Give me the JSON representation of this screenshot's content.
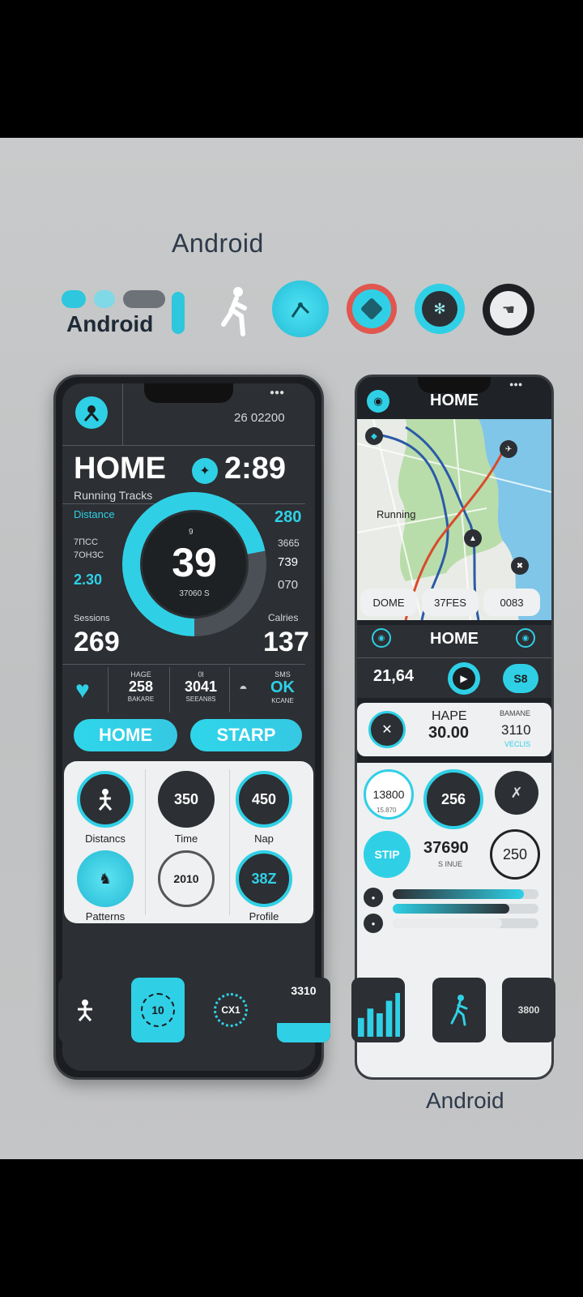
{
  "brand": {
    "title": "Android",
    "footer": "Android",
    "logo_text": "Android"
  },
  "colors": {
    "accent": "#2fd0e6",
    "dark": "#2c2f33",
    "light": "#eef0f1",
    "red": "#e0574f"
  },
  "icons_row": [
    "runner-icon",
    "route-icon",
    "cube-icon",
    "fan-icon",
    "pointer-icon"
  ],
  "left_phone": {
    "status_value": "26 02200",
    "title": "HOME",
    "clock": "2:89",
    "subtitle": "Running Tracks",
    "left_stats": [
      {
        "label": "Distance",
        "value": ""
      },
      {
        "label": "7ПСС",
        "value": ""
      },
      {
        "label": "7ОНЗС",
        "value": ""
      },
      {
        "label": "",
        "value": "2.30"
      }
    ],
    "right_stats": [
      "280",
      "3665",
      "739",
      "070"
    ],
    "ring": {
      "top": "9",
      "value": "39",
      "sub": "37060 S",
      "progress": 0.72
    },
    "bottom_left_label": "Sessions",
    "bottom_left_value": "269",
    "bottom_right_label": "Calries",
    "bottom_right_value": "137",
    "mini_stats": [
      {
        "top": "HAGE",
        "value": "258",
        "sub": "BAKARE"
      },
      {
        "top": "0l",
        "value": "3041",
        "sub": "SEEAN8S"
      },
      {
        "top": "SMS",
        "value": "OK",
        "sub": "KCANE"
      }
    ],
    "btn_home": "HOME",
    "btn_start": "STARP",
    "tiles": [
      {
        "label": "Distancs",
        "value": ""
      },
      {
        "label": "Time",
        "value": "350"
      },
      {
        "label": "Nap",
        "value": "450"
      },
      {
        "label": "Patterns",
        "value": ""
      },
      {
        "label": "",
        "value": "2010"
      },
      {
        "label": "Profile",
        "value": "38Z"
      }
    ]
  },
  "right_phone": {
    "title": "HOME",
    "map_label": "Running",
    "chips": [
      "DOME",
      "37FES",
      "0083"
    ],
    "panel_title": "HOME",
    "panel_value": "21,64",
    "panel_badge": "S8",
    "card": {
      "title": "HAPE",
      "value": "30.00",
      "right_top": "BAMANE",
      "right_value": "3110",
      "right_sub": "VECLIS"
    },
    "circle_a": "13800",
    "circle_a_sub": "15.870",
    "circle_b": "256",
    "circle_c": "STIP",
    "circle_value": "37690",
    "circle_value_sub": "S INUE",
    "circle_d": "250",
    "bars": [
      0.9,
      0.8,
      0.75
    ]
  },
  "bottom_icons": [
    {
      "name": "runner-tile-icon",
      "text": ""
    },
    {
      "name": "timer-tile-icon",
      "text": "10"
    },
    {
      "name": "dial-tile-icon",
      "text": "CX1"
    },
    {
      "name": "score-tile-icon",
      "text": "3310"
    },
    {
      "name": "chart-tile-icon",
      "text": ""
    },
    {
      "name": "walker-tile-icon",
      "text": ""
    },
    {
      "name": "list-tile-icon",
      "text": "3800"
    }
  ]
}
